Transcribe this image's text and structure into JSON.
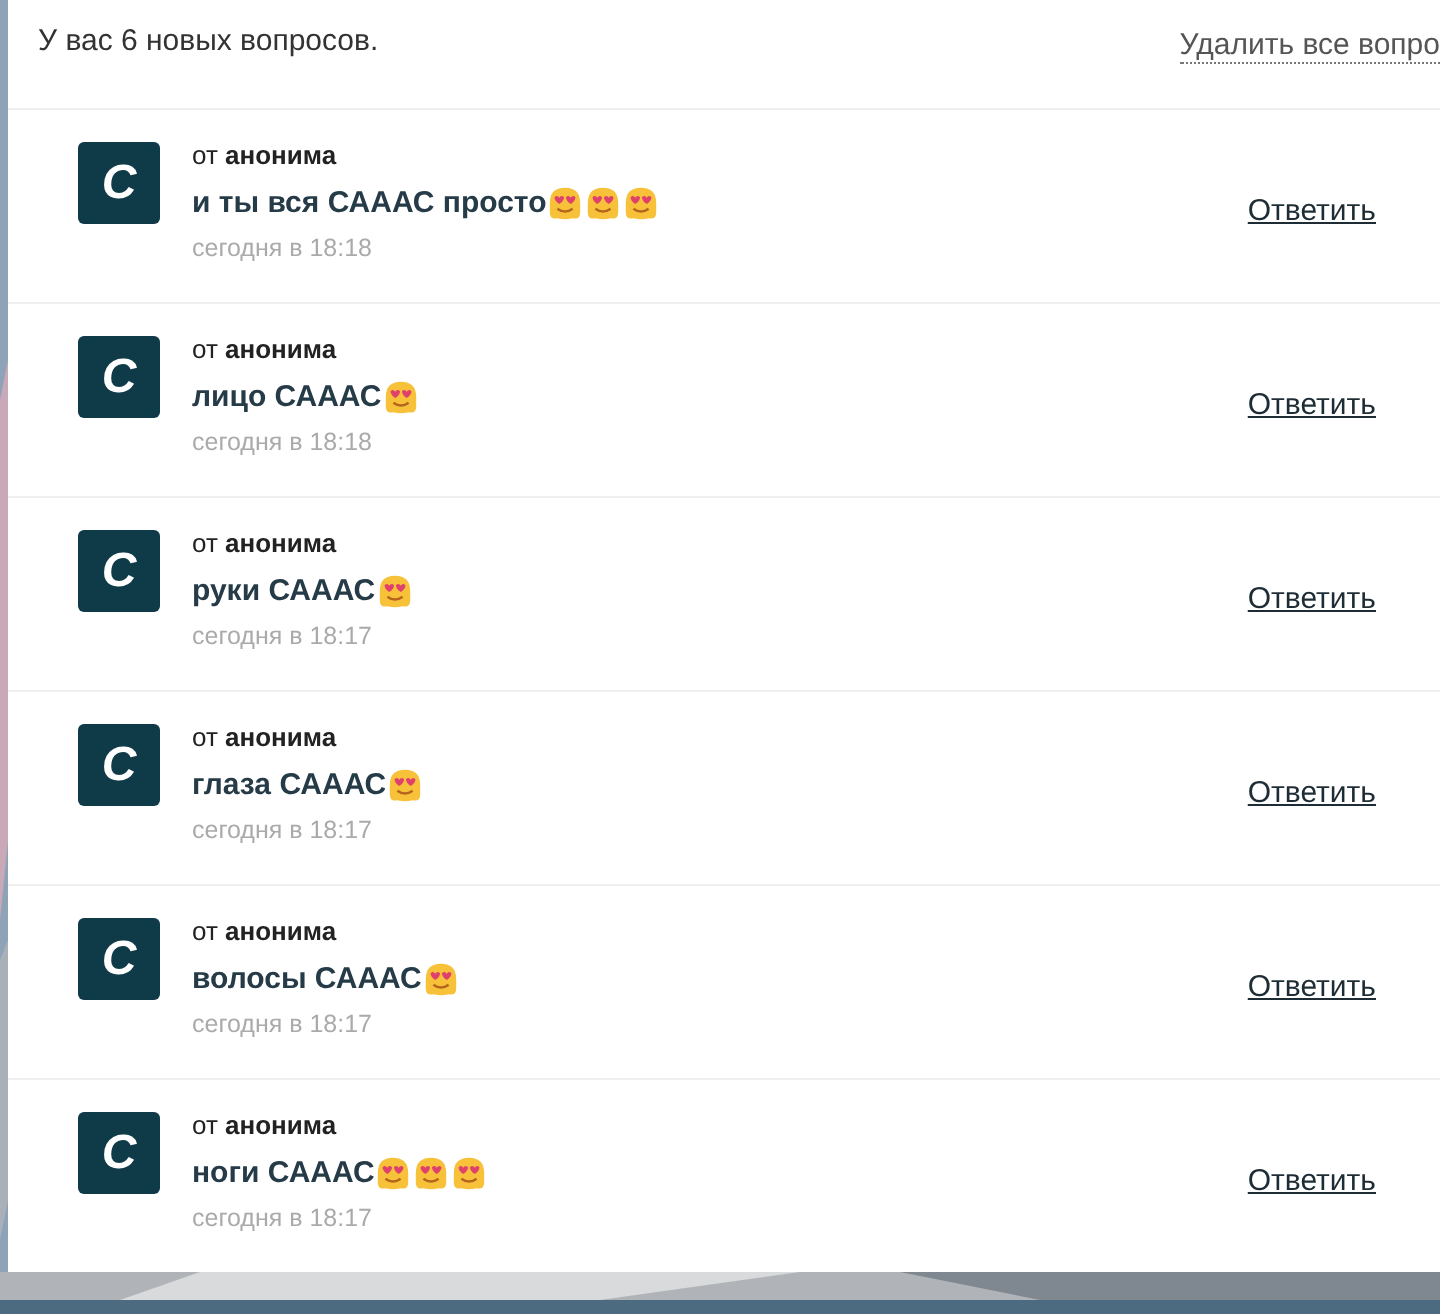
{
  "header": {
    "title": "У вас 6 новых вопросов.",
    "delete_all_link": "Удалить все вопро"
  },
  "questions": [
    {
      "avatar_letter": "C",
      "from_prefix": "от",
      "from": "анонима",
      "text": "и ты вся САААС просто",
      "emoji": [
        {
          "kind": "heart-eyes"
        },
        {
          "kind": "heart-eyes"
        },
        {
          "kind": "heart-eyes"
        }
      ],
      "time": "сегодня в 18:18",
      "reply": "Ответить"
    },
    {
      "avatar_letter": "C",
      "from_prefix": "от",
      "from": "анонима",
      "text": "лицо САААС",
      "emoji": [
        {
          "kind": "heart-eyes"
        }
      ],
      "time": "сегодня в 18:18",
      "reply": "Ответить"
    },
    {
      "avatar_letter": "C",
      "from_prefix": "от",
      "from": "анонима",
      "text": "руки САААС",
      "emoji": [
        {
          "kind": "heart-eyes"
        }
      ],
      "time": "сегодня в 18:17",
      "reply": "Ответить"
    },
    {
      "avatar_letter": "C",
      "from_prefix": "от",
      "from": "анонима",
      "text": "глаза САААС",
      "emoji": [
        {
          "kind": "heart-eyes"
        }
      ],
      "time": "сегодня в 18:17",
      "reply": "Ответить"
    },
    {
      "avatar_letter": "C",
      "from_prefix": "от",
      "from": "анонима",
      "text": "волосы САААС",
      "emoji": [
        {
          "kind": "heart-eyes"
        }
      ],
      "time": "сегодня в 18:17",
      "reply": "Ответить"
    },
    {
      "avatar_letter": "C",
      "from_prefix": "от",
      "from": "анонима",
      "text": "ноги САААС",
      "emoji": [
        {
          "kind": "heart-eyes"
        },
        {
          "kind": "heart-eyes"
        },
        {
          "kind": "heart-eyes"
        }
      ],
      "time": "сегодня в 18:17",
      "reply": "Ответить"
    }
  ]
}
